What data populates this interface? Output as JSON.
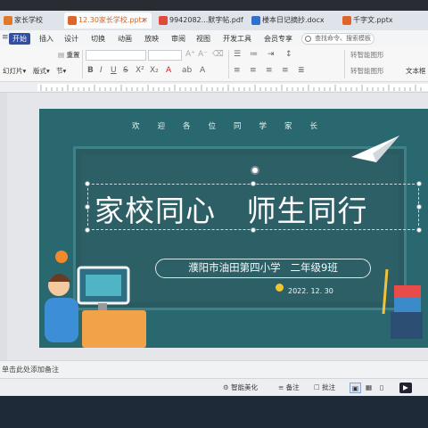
{
  "tabs": [
    {
      "label": "家长学校",
      "color": "#e07a28",
      "active": false
    },
    {
      "label": "12.30家长学校.pptx",
      "color": "#e0652a",
      "active": true
    },
    {
      "label": "9942082...默字帖.pdf",
      "color": "#e04a3a",
      "active": false
    },
    {
      "label": "楼本日记摘抄.docx",
      "color": "#2f6fd0",
      "active": false
    },
    {
      "label": "千字文.pptx",
      "color": "#e0652a",
      "active": false
    }
  ],
  "menu": {
    "items": [
      "开始",
      "插入",
      "设计",
      "切换",
      "动画",
      "放映",
      "审阅",
      "视图",
      "开发工具",
      "会员专享"
    ],
    "search_placeholder": "查找命令、搜索模板"
  },
  "ribbon": {
    "placeholder_btn": "幻灯片",
    "layout_btn": "版式",
    "section_btn": "节",
    "reset_btn": "重置",
    "text_box_btn": "文本框",
    "convert_btn": "转智能图形",
    "text_to_shape_btn": "转智能图形"
  },
  "slide": {
    "welcome": "欢迎各位同学家长",
    "title": "家校同心   师生同行",
    "school": "濮阳市油田第四小学   二年级9班",
    "date": "2022. 12. 30"
  },
  "notes_placeholder": "单击此处添加备注",
  "status": {
    "smart_beautify": "智能美化",
    "notes": "备注",
    "comments": "批注"
  },
  "colors": {
    "slide_bg": "#28686e",
    "board": "#2d5f66",
    "active_menu": "#2f4ea4"
  }
}
